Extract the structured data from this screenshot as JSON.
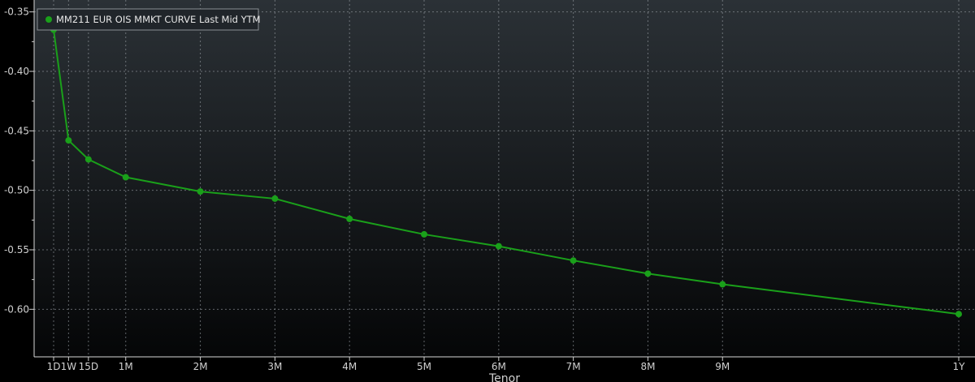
{
  "chart_data": {
    "type": "line",
    "title": "",
    "xlabel": "Tenor",
    "ylabel": "",
    "ylim": [
      -0.64,
      -0.34
    ],
    "y_ticks": [
      -0.35,
      -0.4,
      -0.45,
      -0.5,
      -0.55,
      -0.6
    ],
    "y_tick_labels": [
      "-0.35",
      "-0.40",
      "-0.45",
      "-0.50",
      "-0.55",
      "-0.60"
    ],
    "grid": true,
    "legend_position": "top-left",
    "categories": [
      "1D",
      "1W",
      "15D",
      "1M",
      "2M",
      "3M",
      "4M",
      "5M",
      "6M",
      "7M",
      "8M",
      "9M",
      "1Y"
    ],
    "x_days": [
      1,
      7,
      15,
      30,
      60,
      90,
      120,
      150,
      180,
      210,
      240,
      270,
      365
    ],
    "series": [
      {
        "name": "MM211 EUR OIS MMKT CURVE Last Mid YTM",
        "color": "#1aa01a",
        "values": [
          -0.365,
          -0.458,
          -0.474,
          -0.489,
          -0.501,
          -0.507,
          -0.524,
          -0.537,
          -0.547,
          -0.559,
          -0.57,
          -0.579,
          -0.604
        ]
      }
    ]
  }
}
